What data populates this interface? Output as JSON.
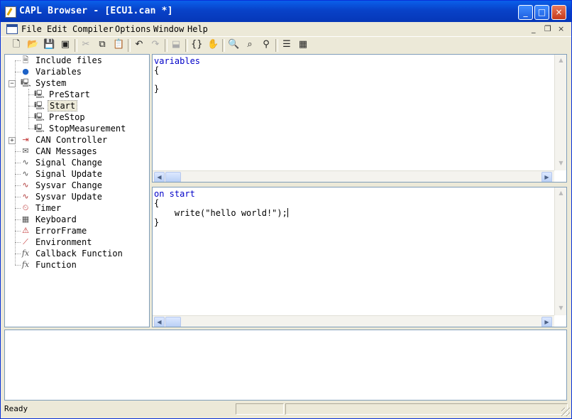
{
  "window": {
    "title": "CAPL Browser - [ECU1.can *]",
    "controls": {
      "minimize": "_",
      "maximize": "□",
      "close": "×"
    }
  },
  "menu": {
    "items": [
      "File",
      "Edit",
      "Compiler",
      "Options",
      "Window",
      "Help"
    ],
    "mdi_controls": [
      "_",
      "❐",
      "×"
    ]
  },
  "toolbar": {
    "icons": [
      "new-file-icon",
      "open-folder-icon",
      "save-icon",
      "save-all-icon",
      "cut-icon",
      "copy-icon",
      "paste-icon",
      "undo-icon",
      "redo-icon",
      "paste-disabled-icon",
      "compile-icon",
      "compile-all-icon",
      "find-icon",
      "find-next-icon",
      "find-prev-icon",
      "database-icon",
      "symbols-icon"
    ]
  },
  "tree": {
    "items": [
      {
        "label": "Include files",
        "icon": "include-files-icon",
        "level": 0
      },
      {
        "label": "Variables",
        "icon": "globe-icon",
        "level": 0
      },
      {
        "label": "System",
        "icon": "computer-icon",
        "level": 0,
        "expanded": true
      },
      {
        "label": "PreStart",
        "icon": "computer-icon",
        "level": 1
      },
      {
        "label": "Start",
        "icon": "computer-icon",
        "level": 1,
        "selected": true
      },
      {
        "label": "PreStop",
        "icon": "computer-icon",
        "level": 1
      },
      {
        "label": "StopMeasurement",
        "icon": "computer-icon",
        "level": 1
      },
      {
        "label": "CAN Controller",
        "icon": "can-controller-icon",
        "level": 0,
        "collapsed": true
      },
      {
        "label": "CAN Messages",
        "icon": "envelope-icon",
        "level": 0
      },
      {
        "label": "Signal Change",
        "icon": "signal-wave-icon",
        "level": 0
      },
      {
        "label": "Signal Update",
        "icon": "signal-wave-icon",
        "level": 0
      },
      {
        "label": "Sysvar Change",
        "icon": "sysvar-icon",
        "level": 0
      },
      {
        "label": "Sysvar Update",
        "icon": "sysvar-icon",
        "level": 0
      },
      {
        "label": "Timer",
        "icon": "clock-icon",
        "level": 0
      },
      {
        "label": "Keyboard",
        "icon": "keyboard-icon",
        "level": 0
      },
      {
        "label": "ErrorFrame",
        "icon": "error-frame-icon",
        "level": 0
      },
      {
        "label": "Environment",
        "icon": "environment-icon",
        "level": 0
      },
      {
        "label": "Callback Function",
        "icon": "function-icon",
        "level": 0
      },
      {
        "label": "Function",
        "icon": "function-icon",
        "level": 0
      }
    ]
  },
  "editor_top": {
    "lines": [
      "variables",
      "{",
      "",
      "}"
    ]
  },
  "editor_bottom": {
    "lines": [
      "on start",
      "{",
      "    write(\"hello world!\");",
      "}"
    ]
  },
  "status": {
    "text": "Ready"
  },
  "colors": {
    "keyword": "#0000C8",
    "title_bar": "#0842C8",
    "chrome": "#ECE9D8"
  }
}
